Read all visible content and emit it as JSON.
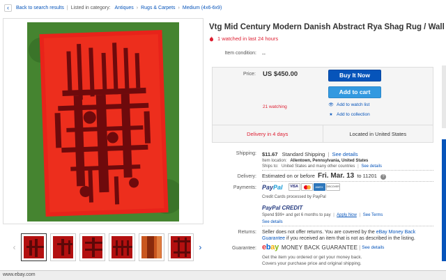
{
  "breadcrumb": {
    "back_label": "Back to search results",
    "listed_in": "Listed in category:",
    "items": [
      "Antiques",
      "Rugs & Carpets",
      "Medium (4x6-6x9)"
    ]
  },
  "title": "Vtg Mid Century Modern Danish Abstract Rya Shag Rug / Wall Pop Art",
  "watched_notice": "1 watched in last 24 hours",
  "condition": {
    "label": "Item condition:",
    "value": "--"
  },
  "buybox": {
    "price_label": "Price:",
    "price": "US $450.00",
    "buy_now": "Buy It Now",
    "add_to_cart": "Add to cart",
    "watching": "21 watching",
    "add_watch": "Add to watch list",
    "add_collection": "Add to collection",
    "delivery_badge": "Delivery in 4 days",
    "location_badge": "Located in United States"
  },
  "shipping": {
    "label": "Shipping:",
    "cost": "$11.67",
    "method": "Standard Shipping",
    "see_details": "See details",
    "location_label": "Item location:",
    "location": "Allentown, Pennsylvania, United States",
    "ships_to_label": "Ships to:",
    "ships_to": "United States and many other countries",
    "ships_see": "See details"
  },
  "delivery": {
    "label": "Delivery:",
    "prefix": "Estimated on or before",
    "date": "Fri. Mar. 13",
    "to": "to 11201"
  },
  "payments": {
    "label": "Payments:",
    "paypal_a": "Pay",
    "paypal_b": "Pal",
    "cards": [
      "VISA",
      "MC",
      "AMEX",
      "DISCOVER"
    ],
    "credit_note": "Credit Cards processed by PayPal",
    "credit_brand": "PayPal CREDIT",
    "credit_offer": "Spend $99+ and get 6 months to pay",
    "apply_now": "Apply Now",
    "see_terms": "See Terms",
    "see_details": "See details"
  },
  "returns": {
    "label": "Returns:",
    "text": "Seller does not offer returns. You are covered by the",
    "link": "eBay Money Back Guarantee",
    "text2": "if you received an item that is not as described in the listing."
  },
  "guarantee": {
    "label": "Guarantee:",
    "logo_e": "e",
    "logo_b": "b",
    "logo_a": "a",
    "logo_y": "y",
    "mbg": "MONEY BACK GUARANTEE",
    "see_details": "See details",
    "line1": "Get the item you ordered or get your money back.",
    "line2": "Covers your purchase price and original shipping."
  },
  "status_bar": "www.ebay.com",
  "thumbnails": [
    "thumb-1",
    "thumb-2",
    "thumb-3",
    "thumb-4",
    "thumb-5",
    "thumb-6"
  ],
  "colors": {
    "accent": "#0654ba",
    "alert": "#dd1e31",
    "rug": "#e8231a"
  }
}
